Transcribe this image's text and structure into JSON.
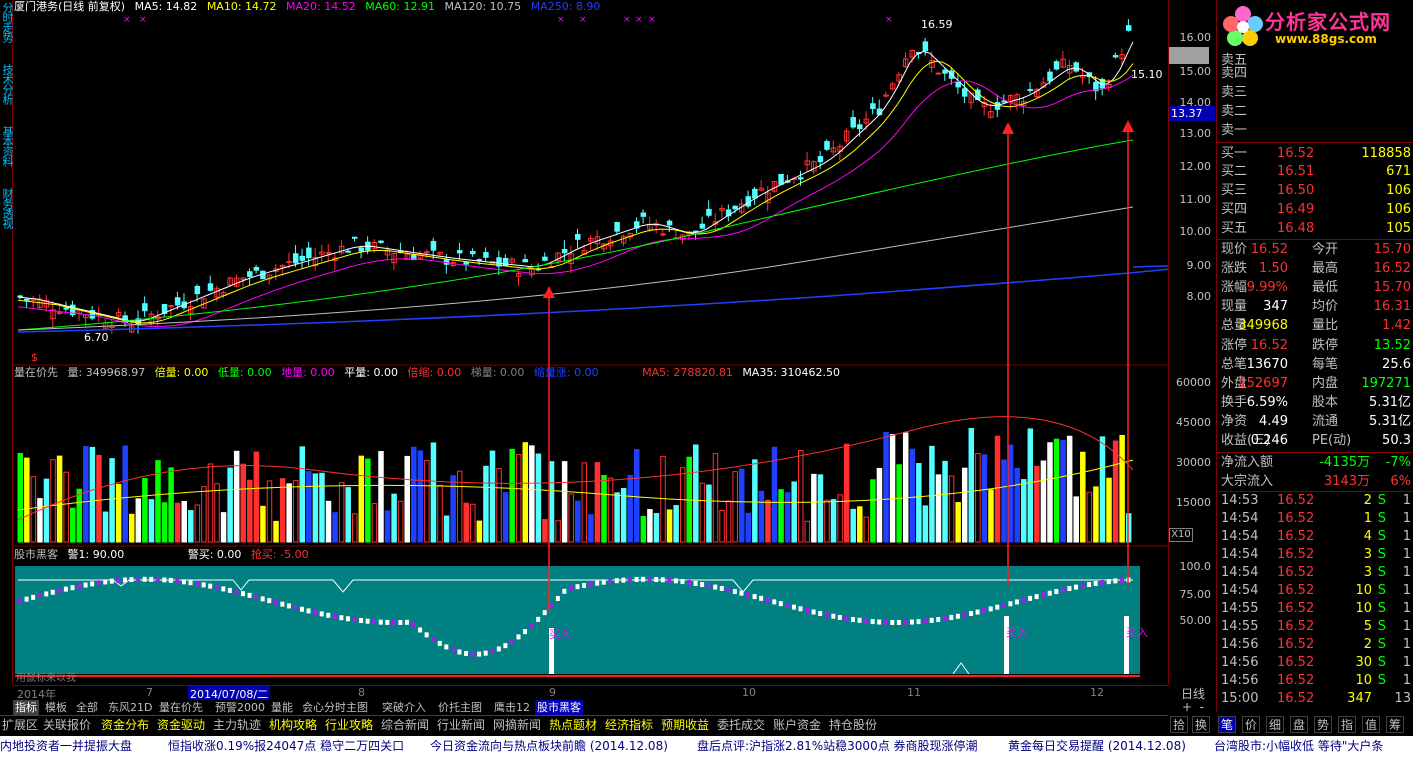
{
  "left_tabs": [
    "分时走势",
    "技术分析",
    "基本资料",
    "财务透视"
  ],
  "main_legend": {
    "title": "厦门港务(日线 前复权)",
    "items": [
      {
        "label": "MA5: 14.82",
        "color": "#ffffff"
      },
      {
        "label": "MA10: 14.72",
        "color": "#ffff00"
      },
      {
        "label": "MA20: 14.52",
        "color": "#ff00ff"
      },
      {
        "label": "MA60: 12.91",
        "color": "#00ff00"
      },
      {
        "label": "MA120: 10.75",
        "color": "#c0c0c0"
      },
      {
        "label": "MA250: 8.90",
        "color": "#2040ff"
      }
    ]
  },
  "vol_legend": {
    "title": "量在价先",
    "items": [
      {
        "label": "量: 349968.97",
        "color": "#c0c0c0"
      },
      {
        "label": "倍量: 0.00",
        "color": "#ffff00"
      },
      {
        "label": "低量: 0.00",
        "color": "#00ff00"
      },
      {
        "label": "地量: 0.00",
        "color": "#ff00ff"
      },
      {
        "label": "平量: 0.00",
        "color": "#ffffff"
      },
      {
        "label": "倍缩: 0.00",
        "color": "#ff3030"
      },
      {
        "label": "梯量: 0.00",
        "color": "#808080"
      },
      {
        "label": "缩量涨: 0.00",
        "color": "#2040ff"
      },
      {
        "label": "MA5: 278820.81",
        "color": "#ff3030"
      },
      {
        "label": "MA35: 310462.50",
        "color": "#ffffff"
      }
    ]
  },
  "ind_legend": {
    "title": "股市黑客",
    "items": [
      {
        "label": "警1: 90.00",
        "color": "#ffffff"
      },
      {
        "label": "警买: 0.00",
        "color": "#ffffff"
      },
      {
        "label": "抢买: -5.00",
        "color": "#ff3030"
      }
    ],
    "buy_label": "买入",
    "bottom_text": "用鼠标来以我"
  },
  "price_annotations": {
    "high": "16.59",
    "low": "6.70",
    "last": "15.10",
    "cursor_price": "13.37",
    "marker": "$"
  },
  "price_axis": [
    "16.00",
    "15.00",
    "14.00",
    "13.00",
    "12.00",
    "11.00",
    "10.00",
    "9.00",
    "8.00"
  ],
  "vol_axis": [
    "60000",
    "45000",
    "30000",
    "15000"
  ],
  "vol_unit": "X10",
  "ind_axis": [
    "100.0",
    "75.00",
    "50.00"
  ],
  "date_axis": {
    "year": "2014年",
    "cursor_date": "2014/07/08/二",
    "months": [
      "7",
      "8",
      "9",
      "10",
      "11",
      "12"
    ]
  },
  "period": "日线",
  "tabs": [
    "指标",
    "模板",
    "全部",
    "东风21D",
    "量在价先",
    "预警2000",
    "量能",
    "会心分时主图",
    "突破介入",
    "价托主图",
    "鹰击12",
    "股市黑客"
  ],
  "func_buttons": [
    "扩展区",
    "关联报价",
    "资金分布",
    "资金驱动",
    "主力轨迹",
    "机构攻略",
    "行业攻略",
    "综合新闻",
    "行业新闻",
    "网摘新闻",
    "热点题材",
    "经济指标",
    "预期收益",
    "委托成交",
    "账户资金",
    "持仓股份"
  ],
  "right_tabs": [
    "拾",
    "换",
    "笔",
    "价",
    "细",
    "盘",
    "势",
    "指",
    "值",
    "筹"
  ],
  "ticker": [
    "内地投资者一并提振大盘",
    "恒指收涨0.19%报24047点 稳守二万四关口",
    "今日资金流向与热点板块前瞻 (2014.12.08)",
    "盘后点评:沪指涨2.81%站稳3000点 券商股现涨停潮",
    "黄金每日交易提醒 (2014.12.08)",
    "台湾股市:小幅收低 等待\"大户条"
  ],
  "logo": {
    "title": "分析家公式网",
    "url": "www.88gs.com"
  },
  "order_book": {
    "sells": [
      "卖五",
      "卖四",
      "卖三",
      "卖二",
      "卖一"
    ],
    "buys": [
      {
        "label": "买一",
        "price": "16.52",
        "vol": "118858"
      },
      {
        "label": "买二",
        "price": "16.51",
        "vol": "671"
      },
      {
        "label": "买三",
        "price": "16.50",
        "vol": "106"
      },
      {
        "label": "买四",
        "price": "16.49",
        "vol": "106"
      },
      {
        "label": "买五",
        "price": "16.48",
        "vol": "105"
      }
    ]
  },
  "stats": [
    {
      "l1": "现价",
      "v1": "16.52",
      "c1": "#ff3030",
      "l2": "今开",
      "v2": "15.70",
      "c2": "#ff3030"
    },
    {
      "l1": "涨跌",
      "v1": "1.50",
      "c1": "#ff3030",
      "l2": "最高",
      "v2": "16.52",
      "c2": "#ff3030"
    },
    {
      "l1": "涨幅",
      "v1": "9.99%",
      "c1": "#ff3030",
      "l2": "最低",
      "v2": "15.70",
      "c2": "#ff3030"
    },
    {
      "l1": "现量",
      "v1": "347",
      "c1": "#ffffff",
      "l2": "均价",
      "v2": "16.31",
      "c2": "#ff3030"
    },
    {
      "l1": "总量",
      "v1": "349968",
      "c1": "#ffff00",
      "l2": "量比",
      "v2": "1.42",
      "c2": "#ff3030"
    },
    {
      "l1": "涨停",
      "v1": "16.52",
      "c1": "#ff3030",
      "l2": "跌停",
      "v2": "13.52",
      "c2": "#00ff00"
    },
    {
      "l1": "总笔",
      "v1": "13670",
      "c1": "#ffffff",
      "l2": "每笔",
      "v2": "25.6",
      "c2": "#ffffff"
    },
    {
      "l1": "外盘",
      "v1": "152697",
      "c1": "#ff3030",
      "l2": "内盘",
      "v2": "197271",
      "c2": "#00ff00"
    },
    {
      "l1": "换手",
      "v1": "6.59%",
      "c1": "#ffffff",
      "l2": "股本",
      "v2": "5.31亿",
      "c2": "#ffffff"
    },
    {
      "l1": "净资",
      "v1": "4.49",
      "c1": "#ffffff",
      "l2": "流通",
      "v2": "5.31亿",
      "c2": "#ffffff"
    },
    {
      "l1": "收益(三)",
      "v1": "0.246",
      "c1": "#ffffff",
      "l2": "PE(动)",
      "v2": "50.3",
      "c2": "#ffffff"
    }
  ],
  "flows": [
    {
      "label": "净流入额",
      "value": "-4135万",
      "pct": "-7%",
      "color": "#00ff00"
    },
    {
      "label": "大宗流入",
      "value": "3143万",
      "pct": "6%",
      "color": "#ff3030"
    }
  ],
  "ticks": [
    {
      "t": "14:53",
      "p": "16.52",
      "v": "2",
      "s": "S",
      "n": "1"
    },
    {
      "t": "14:54",
      "p": "16.52",
      "v": "1",
      "s": "S",
      "n": "1"
    },
    {
      "t": "14:54",
      "p": "16.52",
      "v": "4",
      "s": "S",
      "n": "1"
    },
    {
      "t": "14:54",
      "p": "16.52",
      "v": "3",
      "s": "S",
      "n": "1"
    },
    {
      "t": "14:54",
      "p": "16.52",
      "v": "3",
      "s": "S",
      "n": "1"
    },
    {
      "t": "14:54",
      "p": "16.52",
      "v": "10",
      "s": "S",
      "n": "1"
    },
    {
      "t": "14:55",
      "p": "16.52",
      "v": "10",
      "s": "S",
      "n": "1"
    },
    {
      "t": "14:55",
      "p": "16.52",
      "v": "5",
      "s": "S",
      "n": "1"
    },
    {
      "t": "14:56",
      "p": "16.52",
      "v": "2",
      "s": "S",
      "n": "1"
    },
    {
      "t": "14:56",
      "p": "16.52",
      "v": "30",
      "s": "S",
      "n": "1"
    },
    {
      "t": "14:56",
      "p": "16.52",
      "v": "10",
      "s": "S",
      "n": "1"
    },
    {
      "t": "15:00",
      "p": "16.52",
      "v": "347",
      "s": "",
      "n": "13"
    }
  ]
}
